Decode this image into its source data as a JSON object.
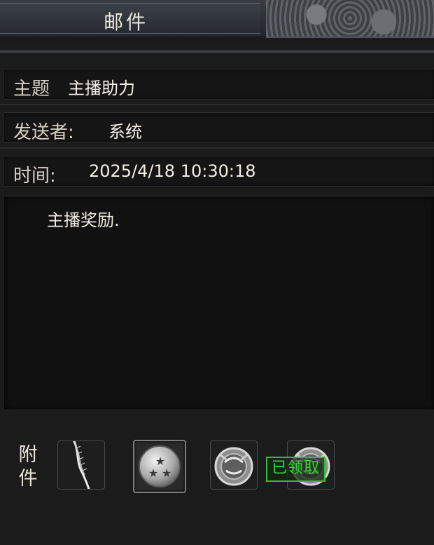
{
  "window": {
    "title": "邮件"
  },
  "mail": {
    "subject_label": "主题",
    "subject_value": "主播助力",
    "sender_label": "发送者:",
    "sender_value": "系统",
    "time_label": "时间:",
    "time_value": "2025/4/18 10:30:18",
    "body": "主播奖励."
  },
  "attachments": {
    "label": "附件",
    "items": [
      {
        "icon": "feather-blade-icon"
      },
      {
        "icon": "three-star-orb-icon"
      },
      {
        "icon": "sealed-scroll-icon"
      },
      {
        "icon": "sealed-scroll-icon"
      }
    ],
    "claimed_badge": "已领取"
  },
  "colors": {
    "badge_green": "#39d43a",
    "panel_bg": "#111111",
    "text": "#f0ece4"
  }
}
